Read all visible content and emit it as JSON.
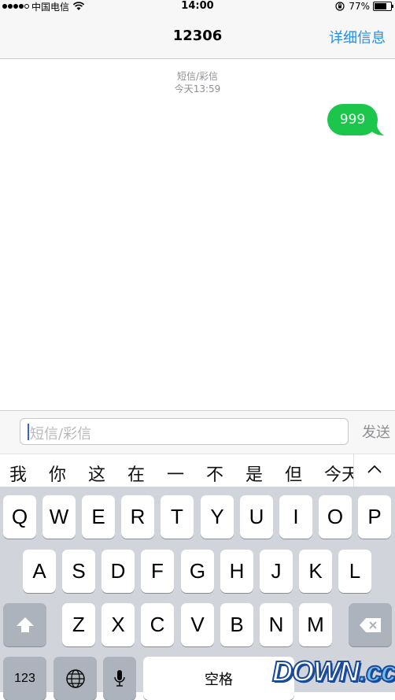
{
  "status_bar": {
    "carrier": "中国电信",
    "time": "14:00",
    "battery_percent_label": "77%",
    "battery_level": 0.77
  },
  "nav": {
    "title": "12306",
    "details_label": "详细信息"
  },
  "conversation": {
    "timestamp_type": "短信/彩信",
    "timestamp_time": "今天13:59",
    "messages": [
      {
        "text": "999",
        "sender": "me"
      }
    ]
  },
  "composer": {
    "placeholder": "短信/彩信",
    "send_label": "发送"
  },
  "candidates": [
    "我",
    "你",
    "这",
    "在",
    "一",
    "不",
    "是",
    "但",
    "今天"
  ],
  "keyboard": {
    "row1": [
      "Q",
      "W",
      "E",
      "R",
      "T",
      "Y",
      "U",
      "I",
      "O",
      "P"
    ],
    "row2": [
      "A",
      "S",
      "D",
      "F",
      "G",
      "H",
      "J",
      "K",
      "L"
    ],
    "row3": [
      "Z",
      "X",
      "C",
      "V",
      "B",
      "N",
      "M"
    ],
    "numbers_label": "123",
    "space_label": "空格"
  },
  "watermark": {
    "part1": "DOWN",
    "part2": ".cc"
  },
  "colors": {
    "accent": "#2a8de6",
    "bubble": "#1bc64b",
    "keyboard_bg": "#d1d5db"
  }
}
